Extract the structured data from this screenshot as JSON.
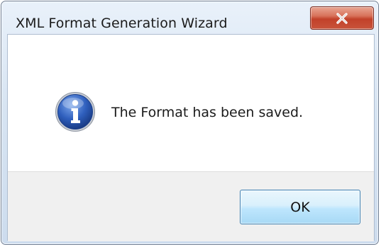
{
  "window": {
    "title": "XML Format Generation Wizard",
    "close_icon": "close-x-icon"
  },
  "message": {
    "icon": "information-icon",
    "text": "The Format has been saved."
  },
  "buttons": {
    "ok_label": "OK"
  },
  "colors": {
    "close_button": "#c8533a",
    "ok_button": "#bee6fd",
    "info_icon": "#2f5fbd"
  }
}
